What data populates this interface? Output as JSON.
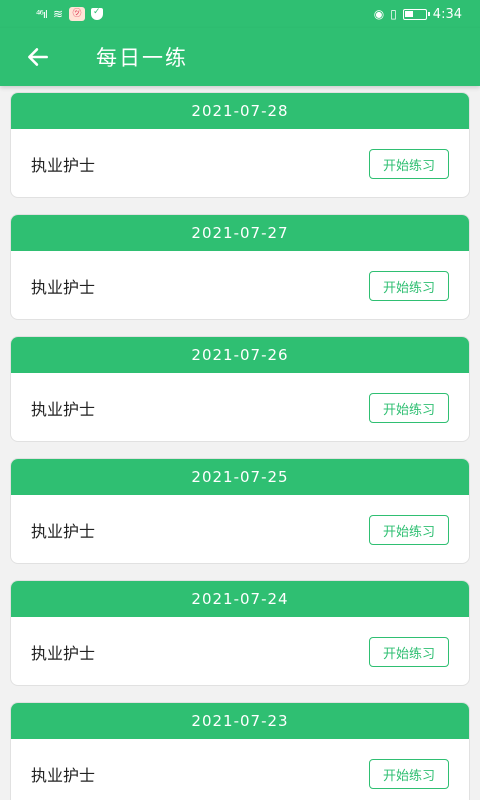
{
  "status_bar": {
    "signal": "⁴⁶ıl",
    "wifi": "≋",
    "avatar": "㋡",
    "eye": "◉",
    "vibrate": "▯",
    "time": "4:34"
  },
  "header": {
    "title": "每日一练"
  },
  "list": {
    "items": [
      {
        "date": "2021-07-28",
        "name": "执业护士",
        "button": "开始练习"
      },
      {
        "date": "2021-07-27",
        "name": "执业护士",
        "button": "开始练习"
      },
      {
        "date": "2021-07-26",
        "name": "执业护士",
        "button": "开始练习"
      },
      {
        "date": "2021-07-25",
        "name": "执业护士",
        "button": "开始练习"
      },
      {
        "date": "2021-07-24",
        "name": "执业护士",
        "button": "开始练习"
      },
      {
        "date": "2021-07-23",
        "name": "执业护士",
        "button": "开始练习"
      }
    ]
  },
  "colors": {
    "accent": "#2fbf72",
    "background": "#f2f2f2"
  },
  "icons": {
    "back": "arrow-left-icon"
  }
}
